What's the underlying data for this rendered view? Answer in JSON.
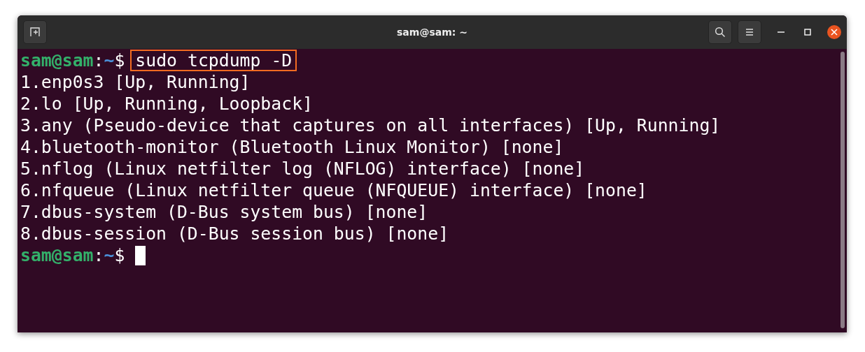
{
  "window": {
    "title": "sam@sam: ~"
  },
  "lines": [
    {
      "kind": "prompt",
      "user": "sam@sam",
      "separator": ":",
      "path": "~",
      "symbol": "$",
      "command": "sudo tcpdump -D",
      "highlighted": true
    },
    {
      "kind": "output",
      "text": "1.enp0s3 [Up, Running]"
    },
    {
      "kind": "output",
      "text": "2.lo [Up, Running, Loopback]"
    },
    {
      "kind": "output",
      "text": "3.any (Pseudo-device that captures on all interfaces) [Up, Running]"
    },
    {
      "kind": "output",
      "text": "4.bluetooth-monitor (Bluetooth Linux Monitor) [none]"
    },
    {
      "kind": "output",
      "text": "5.nflog (Linux netfilter log (NFLOG) interface) [none]"
    },
    {
      "kind": "output",
      "text": "6.nfqueue (Linux netfilter queue (NFQUEUE) interface) [none]"
    },
    {
      "kind": "output",
      "text": "7.dbus-system (D-Bus system bus) [none]"
    },
    {
      "kind": "output",
      "text": "8.dbus-session (D-Bus session bus) [none]"
    },
    {
      "kind": "prompt",
      "user": "sam@sam",
      "separator": ":",
      "path": "~",
      "symbol": "$",
      "cursor": true
    }
  ]
}
